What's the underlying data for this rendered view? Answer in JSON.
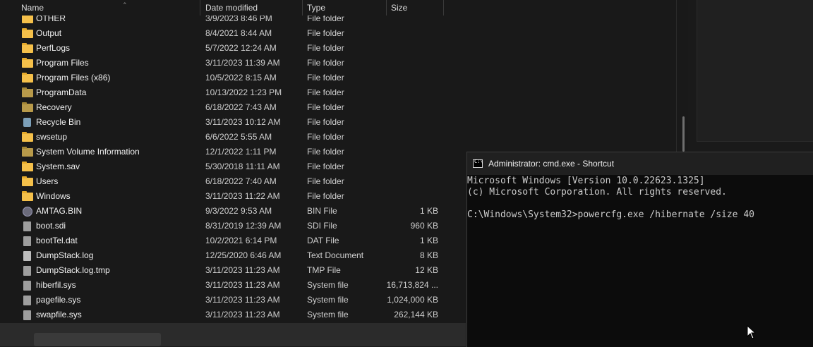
{
  "columns": {
    "name": "Name",
    "date": "Date modified",
    "type": "Type",
    "size": "Size"
  },
  "rows": [
    {
      "icon": "folder",
      "name": "OTHER",
      "date": "3/9/2023 8:46 PM",
      "type": "File folder",
      "size": ""
    },
    {
      "icon": "folder",
      "name": "Output",
      "date": "8/4/2021 8:44 AM",
      "type": "File folder",
      "size": ""
    },
    {
      "icon": "folder",
      "name": "PerfLogs",
      "date": "5/7/2022 12:24 AM",
      "type": "File folder",
      "size": ""
    },
    {
      "icon": "folder",
      "name": "Program Files",
      "date": "3/11/2023 11:39 AM",
      "type": "File folder",
      "size": ""
    },
    {
      "icon": "folder",
      "name": "Program Files (x86)",
      "date": "10/5/2022 8:15 AM",
      "type": "File folder",
      "size": ""
    },
    {
      "icon": "folder-dim",
      "name": "ProgramData",
      "date": "10/13/2022 1:23 PM",
      "type": "File folder",
      "size": ""
    },
    {
      "icon": "folder-dim",
      "name": "Recovery",
      "date": "6/18/2022 7:43 AM",
      "type": "File folder",
      "size": ""
    },
    {
      "icon": "recycle",
      "name": "Recycle Bin",
      "date": "3/11/2023 10:12 AM",
      "type": "File folder",
      "size": ""
    },
    {
      "icon": "folder",
      "name": "swsetup",
      "date": "6/6/2022 5:55 AM",
      "type": "File folder",
      "size": ""
    },
    {
      "icon": "folder-dim",
      "name": "System Volume Information",
      "date": "12/1/2022 1:11 PM",
      "type": "File folder",
      "size": ""
    },
    {
      "icon": "folder",
      "name": "System.sav",
      "date": "5/30/2018 11:11 AM",
      "type": "File folder",
      "size": ""
    },
    {
      "icon": "folder",
      "name": "Users",
      "date": "6/18/2022 7:40 AM",
      "type": "File folder",
      "size": ""
    },
    {
      "icon": "folder",
      "name": "Windows",
      "date": "3/11/2023 11:22 AM",
      "type": "File folder",
      "size": ""
    },
    {
      "icon": "bin",
      "name": "AMTAG.BIN",
      "date": "9/3/2022 9:53 AM",
      "type": "BIN File",
      "size": "1 KB"
    },
    {
      "icon": "file",
      "name": "boot.sdi",
      "date": "8/31/2019 12:39 AM",
      "type": "SDI File",
      "size": "960 KB"
    },
    {
      "icon": "file",
      "name": "bootTel.dat",
      "date": "10/2/2021 6:14 PM",
      "type": "DAT File",
      "size": "1 KB"
    },
    {
      "icon": "doc",
      "name": "DumpStack.log",
      "date": "12/25/2020 6:46 AM",
      "type": "Text Document",
      "size": "8 KB"
    },
    {
      "icon": "file",
      "name": "DumpStack.log.tmp",
      "date": "3/11/2023 11:23 AM",
      "type": "TMP File",
      "size": "12 KB"
    },
    {
      "icon": "file",
      "name": "hiberfil.sys",
      "date": "3/11/2023 11:23 AM",
      "type": "System file",
      "size": "16,713,824 ..."
    },
    {
      "icon": "file",
      "name": "pagefile.sys",
      "date": "3/11/2023 11:23 AM",
      "type": "System file",
      "size": "1,024,000 KB"
    },
    {
      "icon": "file",
      "name": "swapfile.sys",
      "date": "3/11/2023 11:23 AM",
      "type": "System file",
      "size": "262,144 KB"
    }
  ],
  "cmd": {
    "title": "Administrator: cmd.exe - Shortcut",
    "line1": "Microsoft Windows [Version 10.0.22623.1325]",
    "line2": "(c) Microsoft Corporation. All rights reserved.",
    "line3": "",
    "line4": "C:\\Windows\\System32>powercfg.exe /hibernate /size 40"
  }
}
